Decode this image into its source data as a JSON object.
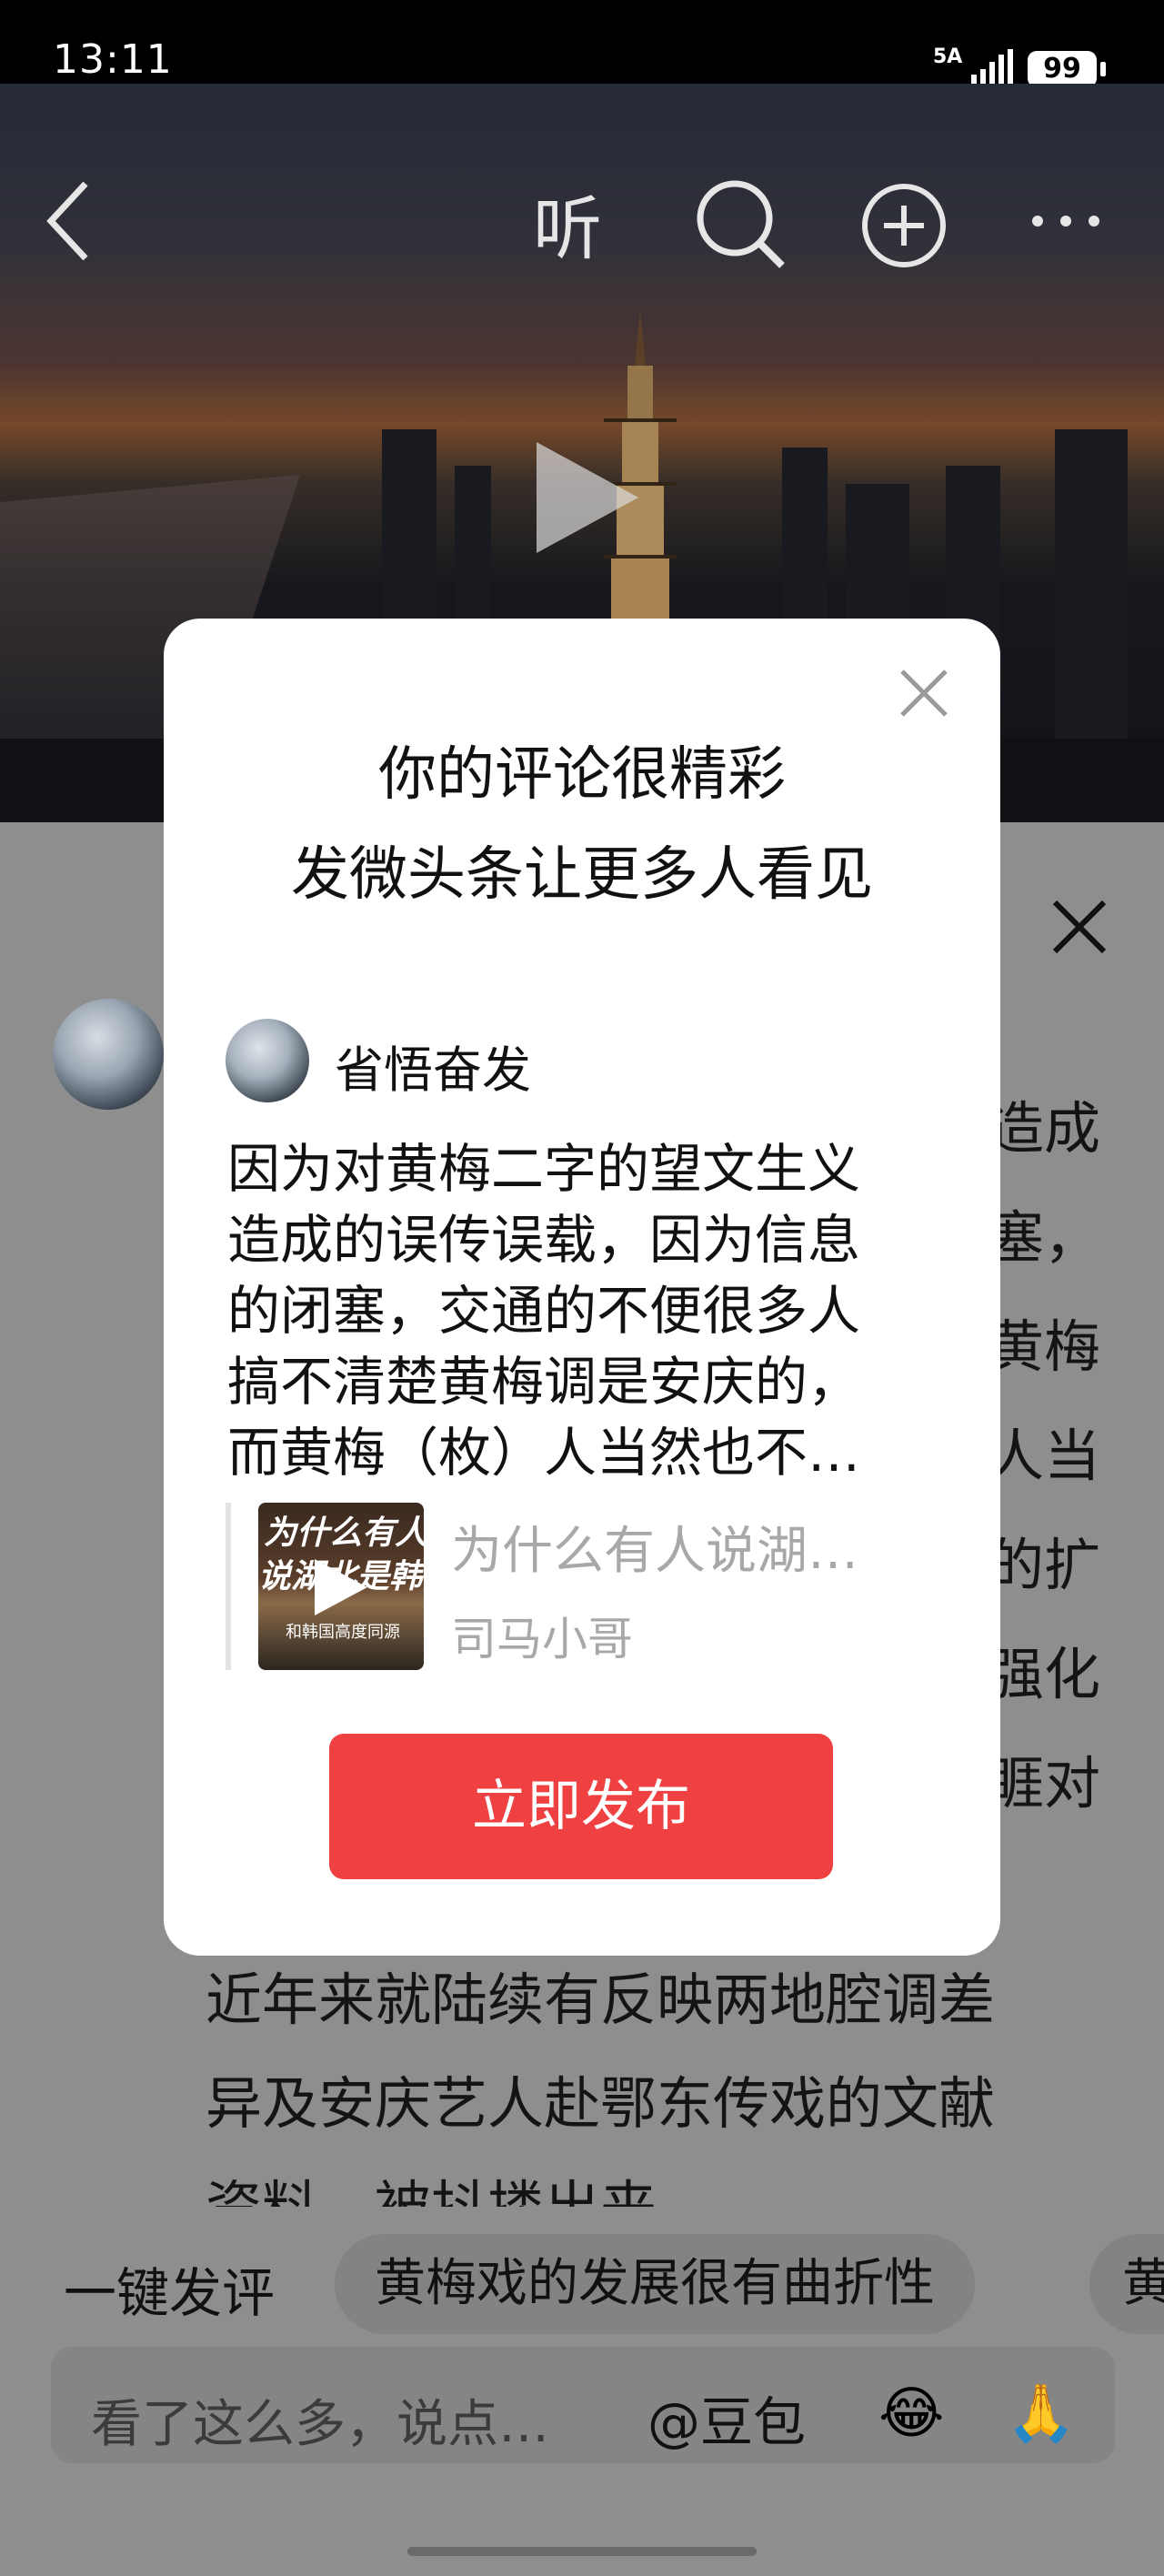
{
  "status_bar": {
    "time": "13:11",
    "network": "5A",
    "battery": "99"
  },
  "header": {
    "listen_label": "听"
  },
  "background": {
    "lines": [
      "近年来就陆续有反映两地腔调差",
      "异及安庆艺人赴鄂东传戏的文献",
      "资料，被抖搂出来"
    ],
    "right_fragments": [
      "造成",
      "塞，",
      "黄梅",
      "人当",
      "的扩",
      "强化",
      "睚对"
    ]
  },
  "bottom_bar": {
    "quick_comment_label": "一键发评",
    "chips": [
      "黄梅戏的发展很有曲折性",
      "黄"
    ],
    "comment_placeholder": "看了这么多，说点…",
    "doubao_label": "@豆包"
  },
  "modal": {
    "title_line1": "你的评论很精彩",
    "title_line2": "发微头条让更多人看见",
    "username": "省悟奋发",
    "comment_lines": [
      "因为对黄梅二字的望文生义",
      "造成的误传误载，因为信息",
      "的闭塞，交通的不便很多人",
      "搞不清楚黄梅调是安庆的，",
      "而黄梅（枚）人当然也不…"
    ],
    "quote": {
      "thumb_text_line1": "为什么有人",
      "thumb_text_line2": "说湖北是韩国",
      "thumb_caption": "和韩国高度同源",
      "title": "为什么有人说湖…",
      "author": "司马小哥"
    },
    "publish_label": "立即发布"
  },
  "colors": {
    "accent": "#f04142",
    "overlay": "#8e8e8e",
    "modal_bg": "#ffffff"
  }
}
